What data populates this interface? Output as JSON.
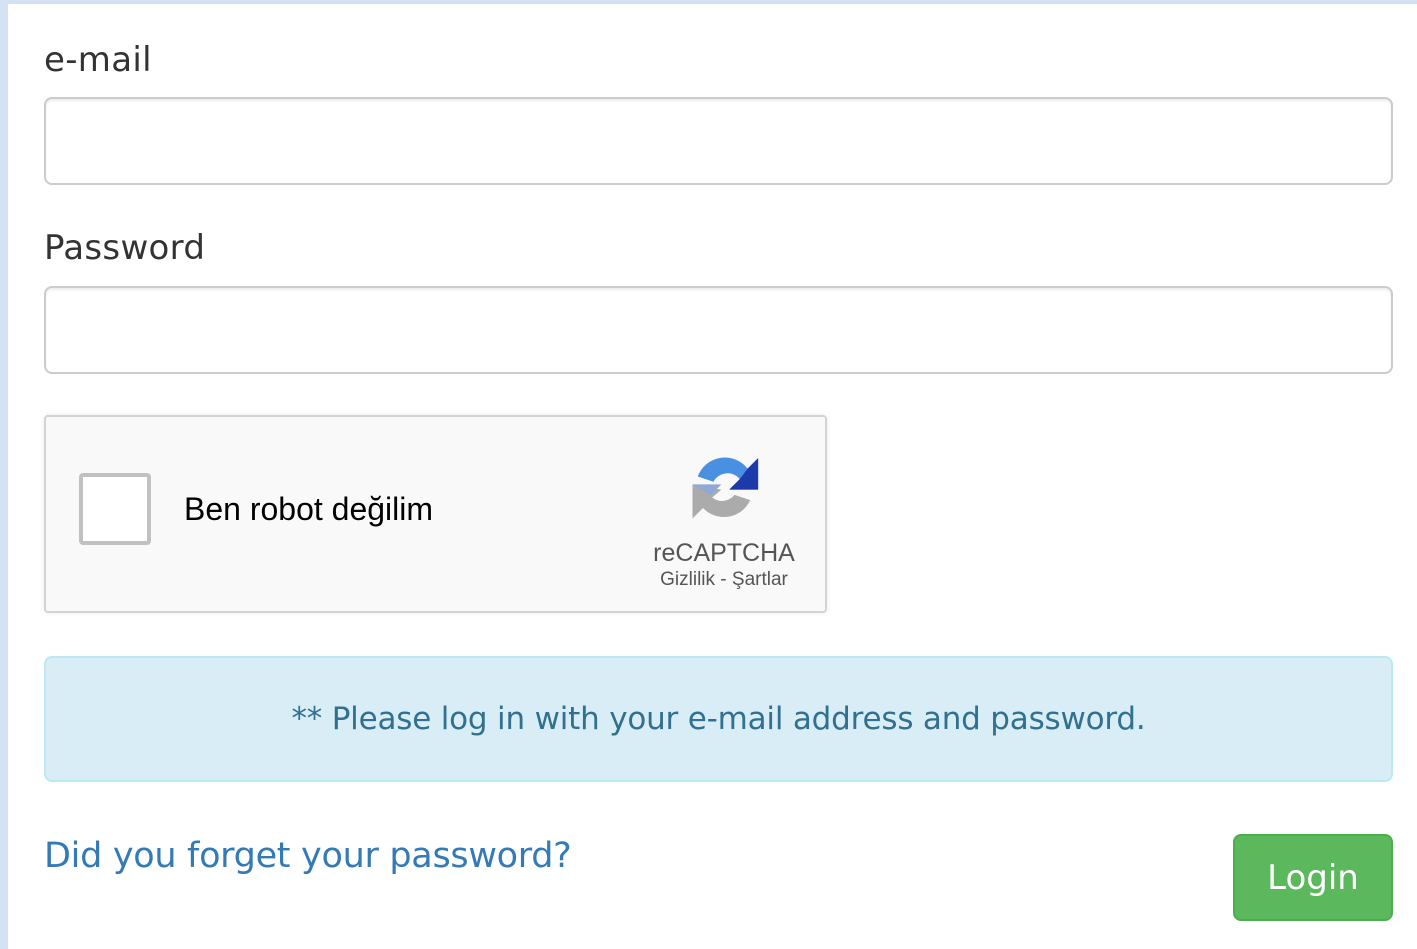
{
  "form": {
    "email_label": "e-mail",
    "email_value": "",
    "email_placeholder": "",
    "password_label": "Password",
    "password_value": "",
    "password_placeholder": ""
  },
  "captcha": {
    "label": "Ben robot değilim",
    "brand": "reCAPTCHA",
    "privacy_link": "Gizlilik",
    "separator": " - ",
    "terms_link": "Şartlar",
    "checked": false
  },
  "alert": {
    "message": "** Please log in with your e-mail address and password."
  },
  "actions": {
    "forgot_password_link": "Did you forget your password?",
    "login_label": "Login"
  },
  "colors": {
    "alert_bg": "#d9edf7",
    "alert_text": "#31708f",
    "link": "#337ab7",
    "login_button": "#5cb85c"
  }
}
